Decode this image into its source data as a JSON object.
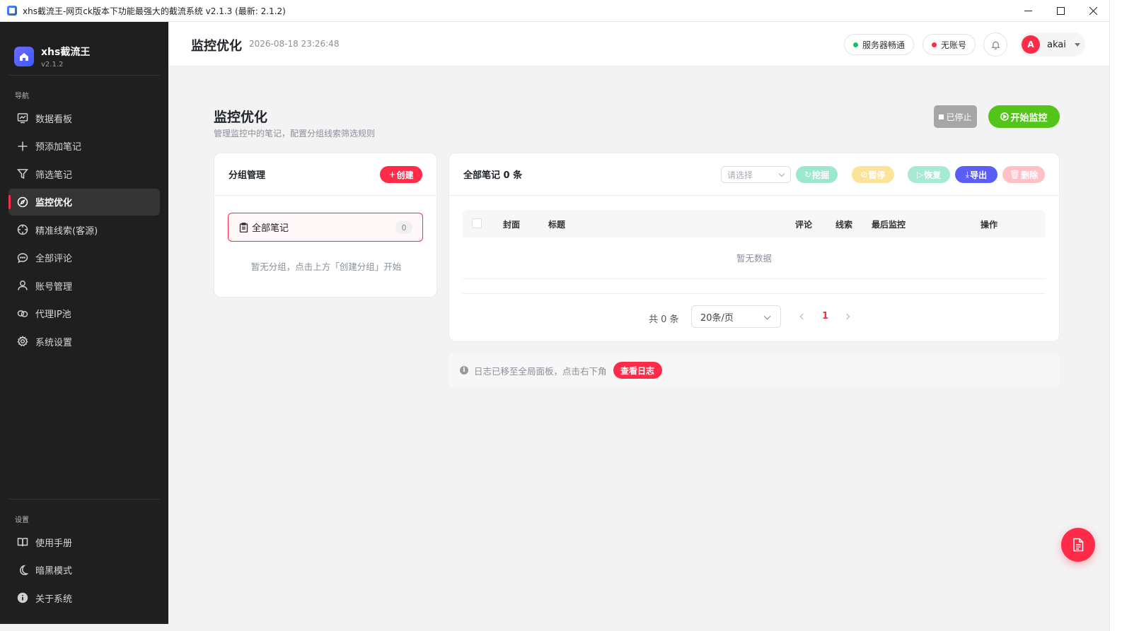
{
  "window": {
    "title": "xhs截流王-网页ck版本下功能最强大的截流系统 v2.1.3 (最新: 2.1.2)"
  },
  "brand": {
    "name": "xhs截流王",
    "version": "v2.1.2",
    "logo_color": "#5a64ff"
  },
  "sidebar": {
    "nav_section": "导航",
    "items": [
      {
        "label": "数据看板",
        "icon": "chart-icon",
        "active": false
      },
      {
        "label": "预添加笔记",
        "icon": "plus-icon",
        "active": false
      },
      {
        "label": "筛选笔记",
        "icon": "filter-icon",
        "active": false
      },
      {
        "label": "监控优化",
        "icon": "compass-icon",
        "active": true
      },
      {
        "label": "精准线索(客源)",
        "icon": "target-icon",
        "active": false
      },
      {
        "label": "全部评论",
        "icon": "comment-icon",
        "active": false
      },
      {
        "label": "账号管理",
        "icon": "user-icon",
        "active": false
      },
      {
        "label": "代理IP池",
        "icon": "link-icon",
        "active": false
      },
      {
        "label": "系统设置",
        "icon": "gear-icon",
        "active": false
      }
    ],
    "settings_section": "设置",
    "bottom_items": [
      {
        "label": "使用手册",
        "icon": "book-icon"
      },
      {
        "label": "暗黑模式",
        "icon": "moon-icon"
      },
      {
        "label": "关于系统",
        "icon": "info-icon"
      }
    ]
  },
  "header": {
    "title": "监控优化",
    "timestamp": "2026-08-18 23:26:48",
    "server_status": "服务器畅通",
    "server_status_color": "#19be6b",
    "account_status": "无账号",
    "account_status_color": "#ff2b49",
    "user": {
      "avatar_letter": "A",
      "name": "akai"
    }
  },
  "page": {
    "title": "监控优化",
    "subtitle": "管理监控中的笔记，配置分组线索筛选规则",
    "stopped_label": "已停止",
    "start_label": "开始监控"
  },
  "groups": {
    "title": "分组管理",
    "create_label": "创建",
    "all_notes_label": "全部笔记",
    "all_notes_count": "0",
    "empty_hint": "暂无分组，点击上方「创建分组」开始"
  },
  "notes": {
    "title": "全部笔记 0 条",
    "select_placeholder": "请选择",
    "actions": [
      {
        "label": "挖掘",
        "color": "#9be8cd"
      },
      {
        "label": "暂停",
        "color": "#fbe39a"
      },
      {
        "label": "恢复",
        "color": "#a6ead4"
      },
      {
        "label": "导出",
        "color": "#5b5ef5"
      },
      {
        "label": "删除",
        "color": "#ffc0c8"
      }
    ],
    "columns": [
      "封面",
      "标题",
      "评论",
      "线索",
      "最后监控",
      "操作"
    ],
    "empty_text": "暂无数据",
    "pagination": {
      "total_text": "共 0 条",
      "page_size": "20条/页",
      "current_page": "1"
    }
  },
  "log_bar": {
    "text": "日志已移至全局面板，点击右下角",
    "button_label": "查看日志"
  },
  "colors": {
    "accent": "#ff2b49",
    "success": "#52c41a",
    "sidebar_bg": "#1f1f1f"
  }
}
